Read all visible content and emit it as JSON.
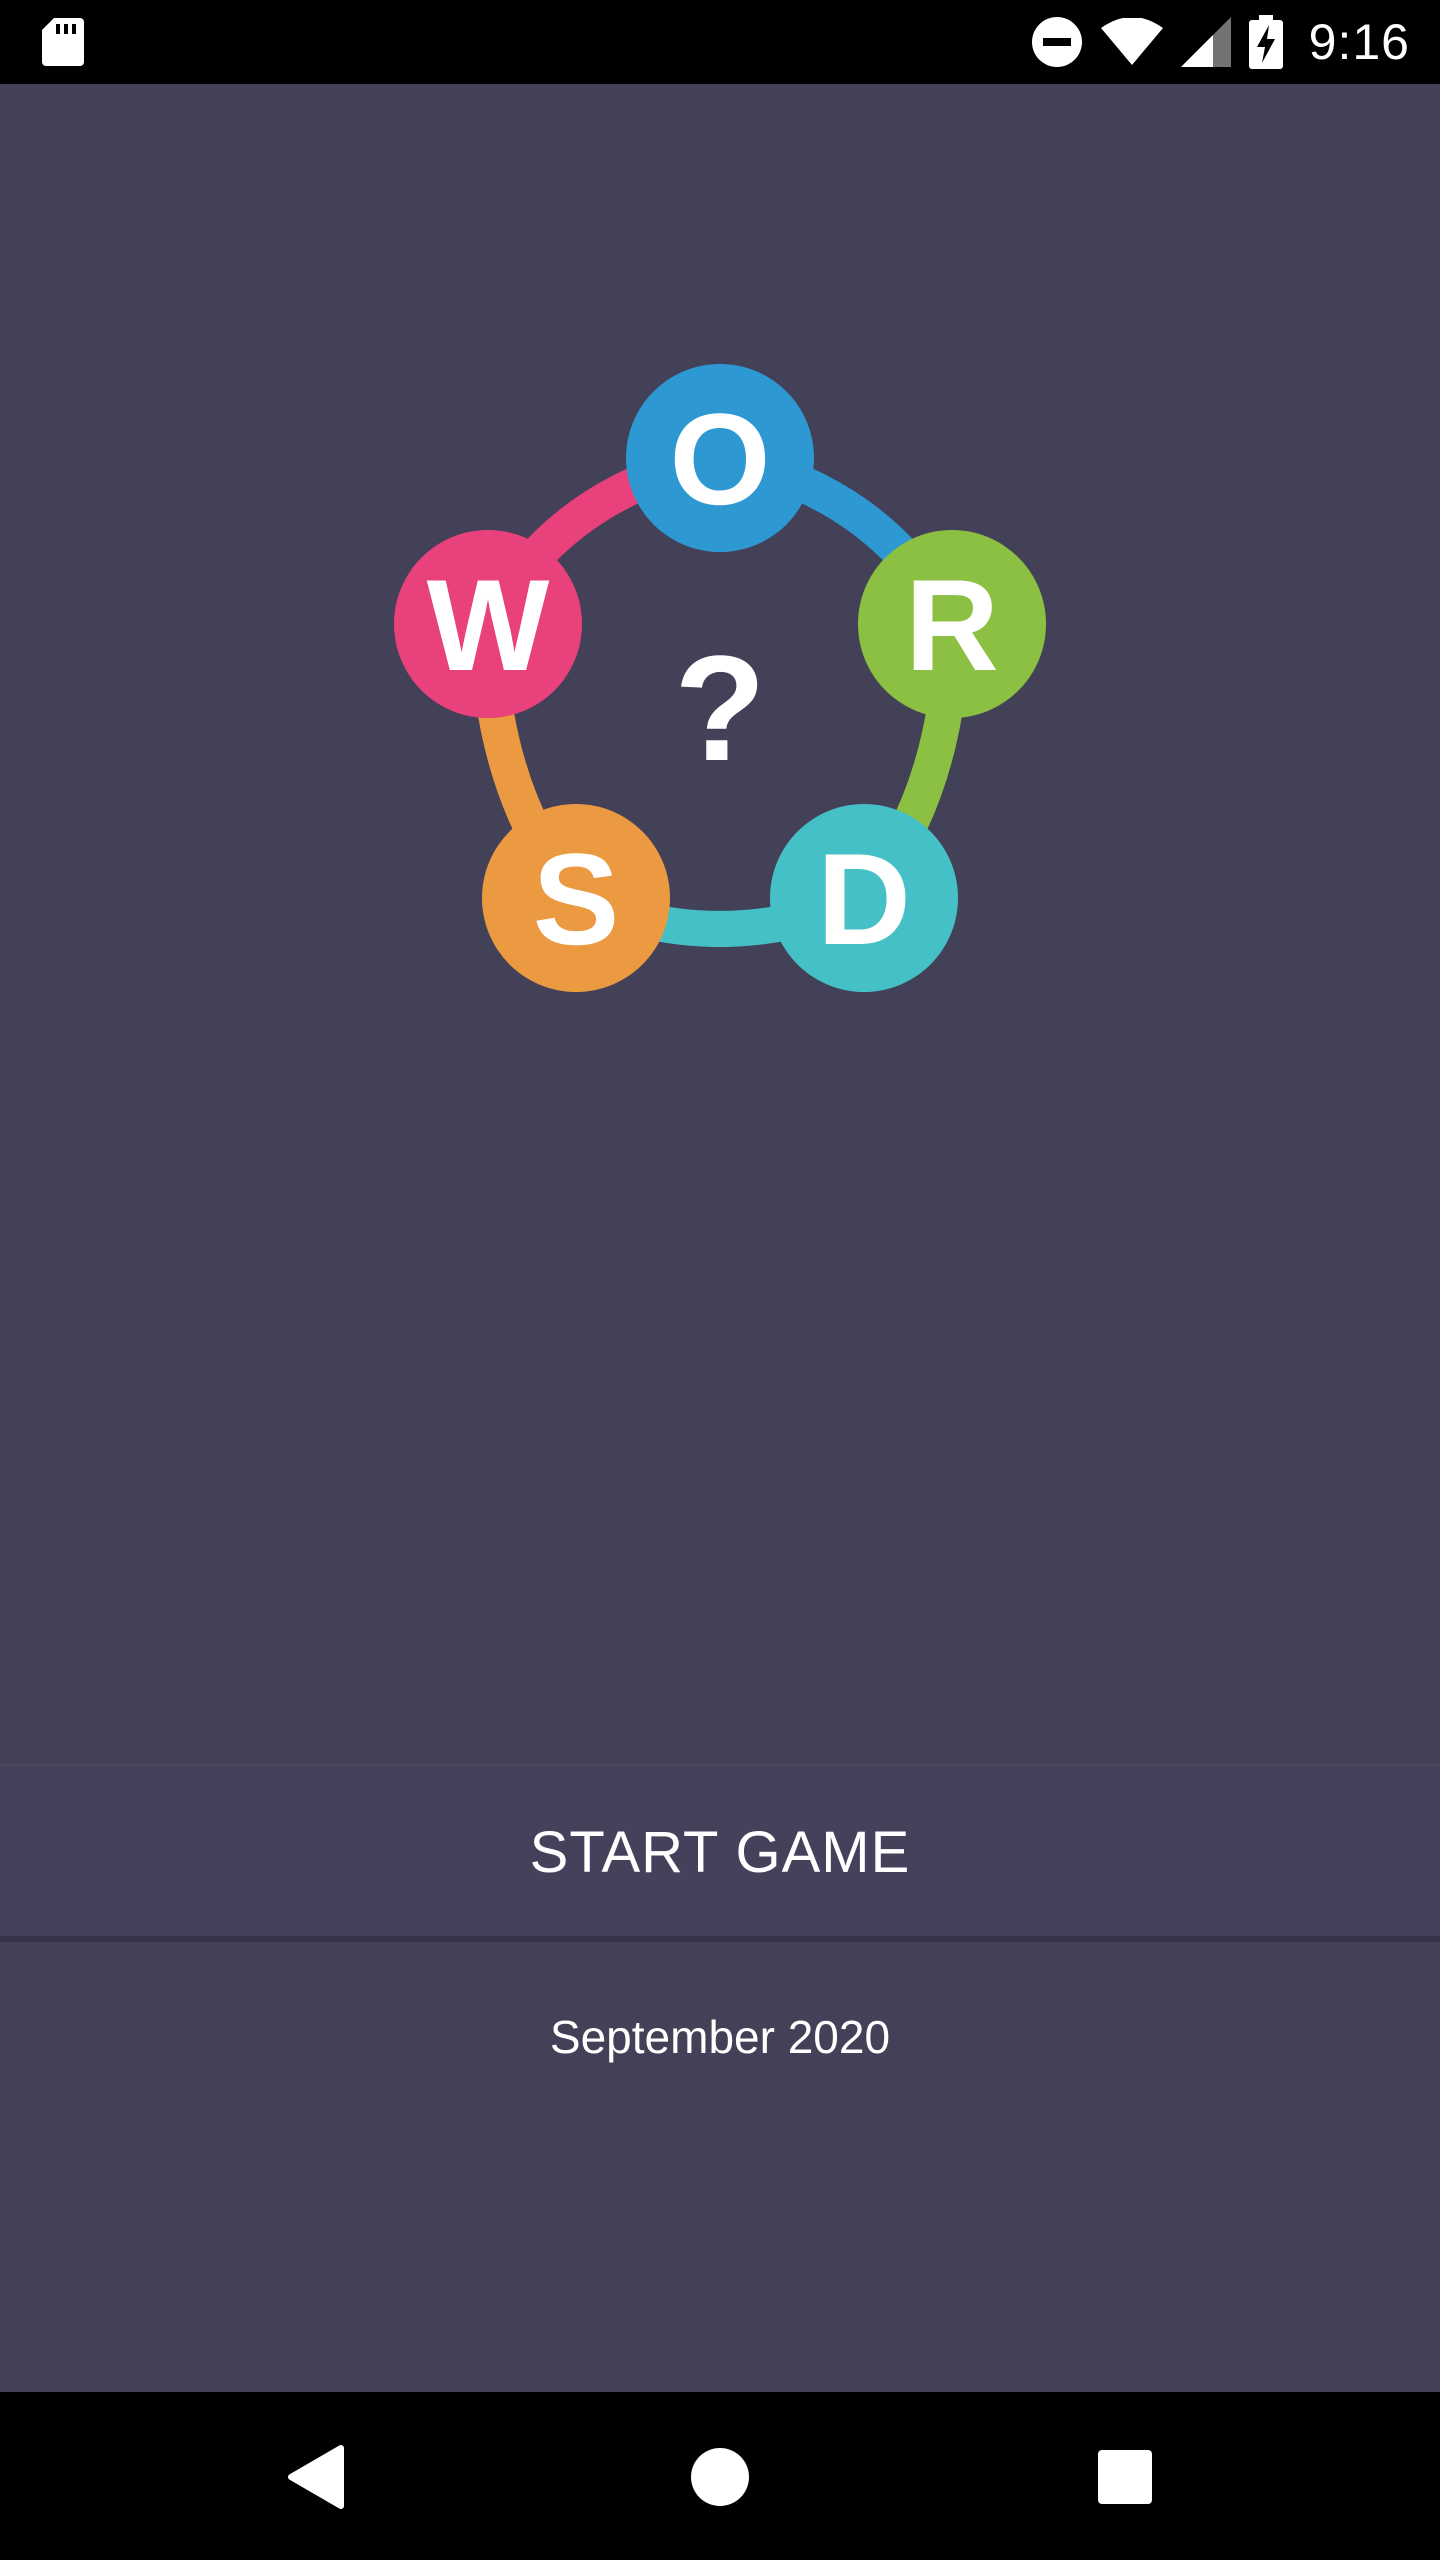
{
  "status_bar": {
    "time": "9:16",
    "icons": [
      "sd-card-icon",
      "do-not-disturb-icon",
      "wifi-icon",
      "cell-signal-icon",
      "battery-charging-icon"
    ]
  },
  "logo": {
    "letters": [
      "W",
      "O",
      "R",
      "D",
      "S"
    ],
    "center_symbol": "?",
    "colors": {
      "w": "#e8417b",
      "o": "#2e98d3",
      "r": "#8cc043",
      "d": "#45c0c7",
      "s": "#eb9a41",
      "background": "#434157"
    }
  },
  "menu": {
    "start_label": "START GAME",
    "date_label": "September 2020"
  },
  "nav_bar": {
    "icons": [
      "back-icon",
      "home-icon",
      "recents-icon"
    ]
  }
}
